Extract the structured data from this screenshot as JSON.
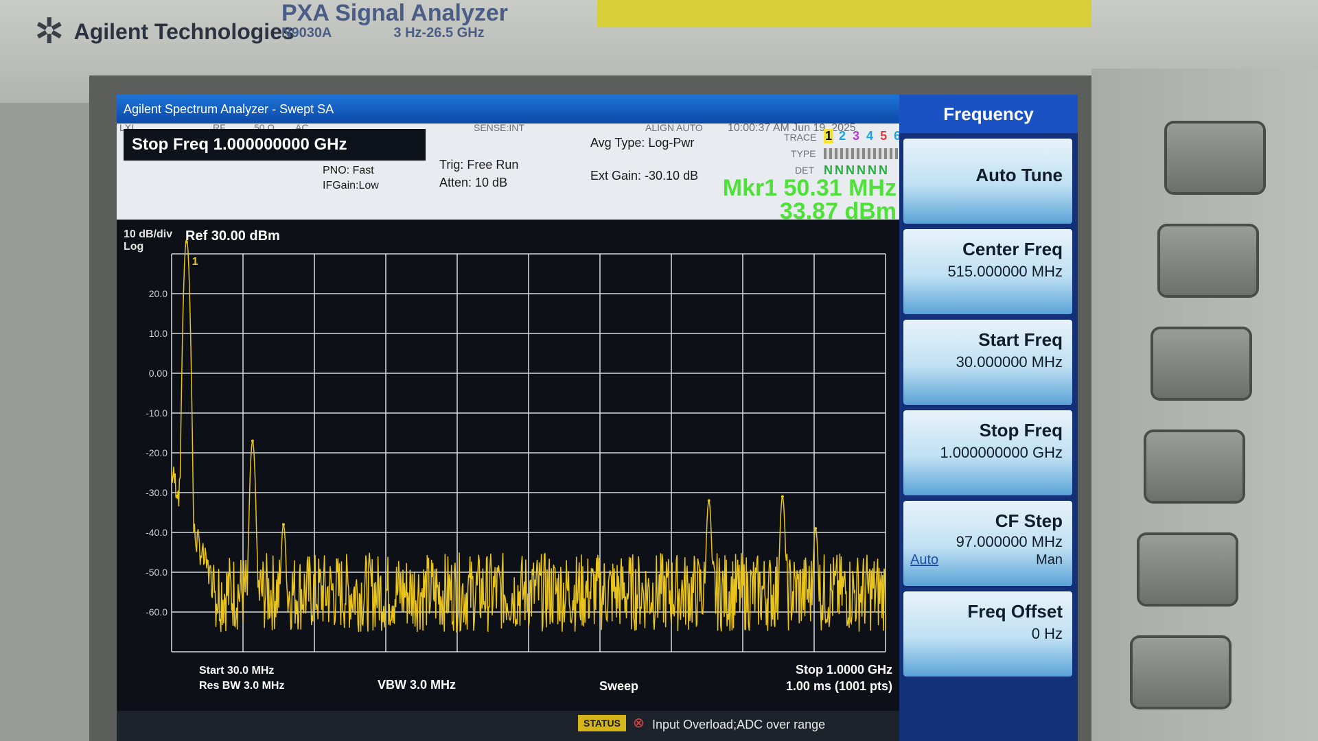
{
  "device": {
    "brand": "Agilent Technologies",
    "model_name": "PXA Signal Analyzer",
    "model_number": "N9030A",
    "freq_range": "3 Hz-26.5 GHz"
  },
  "window": {
    "title": "Agilent Spectrum Analyzer - Swept SA"
  },
  "status": {
    "mini_labels": [
      "LXI",
      "RF",
      "50 Ω",
      "AC",
      "SENSE:INT",
      "ALIGN AUTO"
    ],
    "timestamp": "10:00:37 AM Jun 19, 2025",
    "active_param": "Stop Freq 1.000000000 GHz",
    "pno": "PNO: Fast",
    "ifgain": "IFGain:Low",
    "trigger": "Trig: Free Run",
    "atten": "Atten: 10 dB",
    "avg_type": "Avg Type: Log-Pwr",
    "ext_gain": "Ext Gain: -30.10 dB",
    "trace_label": "TRACE",
    "type_label": "TYPE",
    "det_label": "DET",
    "traces": [
      "1",
      "2",
      "3",
      "4",
      "5",
      "6"
    ],
    "trace_colors": [
      "#111111",
      "#1aa3e8",
      "#b23ad0",
      "#1aa3e8",
      "#e23a3a",
      "#1aa3e8"
    ],
    "det": "NNNNNN"
  },
  "marker": {
    "freq": "Mkr1 50.31 MHz",
    "amp": "33.87 dBm"
  },
  "plot": {
    "scale_label": "10 dB/div",
    "log_label": "Log",
    "ref_label": "Ref 30.00 dBm",
    "y_ticks": [
      "20.0",
      "10.0",
      "0.00",
      "-10.0",
      "-20.0",
      "-30.0",
      "-40.0",
      "-50.0",
      "-60.0"
    ],
    "trace_color": "#e9c41c",
    "start": "Start 30.0 MHz",
    "res_bw": "Res BW 3.0 MHz",
    "vbw": "VBW 3.0 MHz",
    "stop": "Stop 1.0000 GHz",
    "sweep_label": "Sweep",
    "sweep_value": "1.00 ms (1001 pts)",
    "status_badge": "STATUS",
    "error_msg": "Input Overload;ADC over range"
  },
  "chart_data": {
    "type": "line",
    "x_unit": "MHz",
    "y_unit": "dBm",
    "xlim": [
      30,
      1000
    ],
    "ylim": [
      -70,
      30
    ],
    "noise_floor_dbm": -55,
    "peaks": [
      {
        "x": 50.31,
        "y": 33.87
      },
      {
        "x": 140,
        "y": -17
      },
      {
        "x": 182,
        "y": -38
      },
      {
        "x": 760,
        "y": -32
      },
      {
        "x": 860,
        "y": -31
      },
      {
        "x": 905,
        "y": -39
      }
    ]
  },
  "softkeys": {
    "title": "Frequency",
    "items": [
      {
        "label": "Auto Tune",
        "value": ""
      },
      {
        "label": "Center Freq",
        "value": "515.000000 MHz"
      },
      {
        "label": "Start Freq",
        "value": "30.000000 MHz"
      },
      {
        "label": "Stop Freq",
        "value": "1.000000000 GHz"
      },
      {
        "label": "CF Step",
        "value": "97.000000 MHz",
        "mode_left": "Auto",
        "mode_right": "Man"
      },
      {
        "label": "Freq Offset",
        "value": "0 Hz"
      }
    ]
  }
}
